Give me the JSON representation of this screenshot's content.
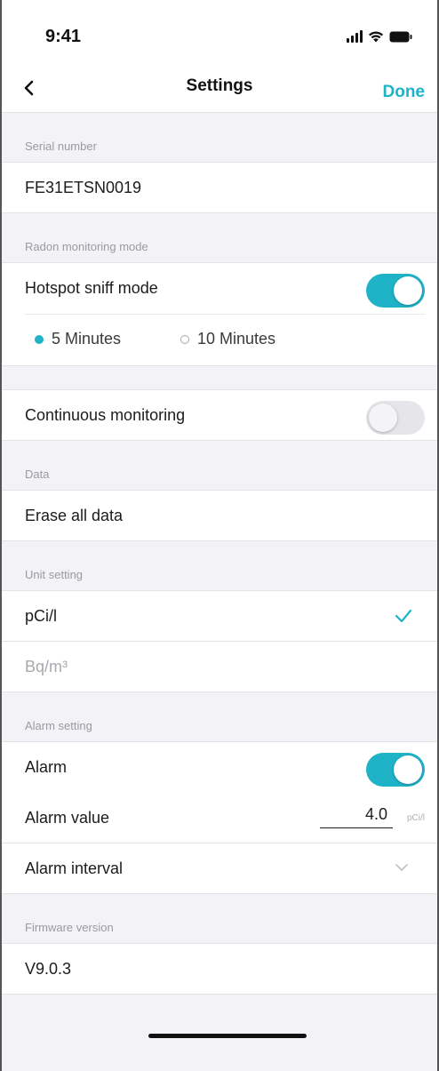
{
  "status_bar": {
    "time": "9:41",
    "icons": [
      "signal-icon",
      "wifi-icon",
      "battery-icon"
    ]
  },
  "nav": {
    "back_icon": "chevron-left-icon",
    "title": "Settings",
    "done_label": "Done"
  },
  "colors": {
    "accent": "#1fb3c7",
    "background": "#f2f2f7",
    "divider": "#e2e2e7"
  },
  "serial": {
    "header": "Serial number",
    "value": "FE31ETSN0019"
  },
  "radon_mode": {
    "header": "Radon monitoring mode",
    "hotspot_label": "Hotspot sniff mode",
    "hotspot_enabled": true,
    "options": [
      {
        "label": "5 Minutes",
        "selected": true
      },
      {
        "label": "10 Minutes",
        "selected": false
      }
    ],
    "continuous_label": "Continuous monitoring",
    "continuous_enabled": false
  },
  "data_section": {
    "header": "Data",
    "erase_label": "Erase all data"
  },
  "unit_setting": {
    "header": "Unit setting",
    "options": [
      {
        "label": "pCi/l",
        "selected": true
      },
      {
        "label": "Bq/m³",
        "selected": false
      }
    ]
  },
  "alarm_setting": {
    "header": "Alarm setting",
    "alarm_label": "Alarm",
    "alarm_enabled": true,
    "value_label": "Alarm value",
    "value": "4.0",
    "unit": "pCi/l",
    "interval_label": "Alarm interval"
  },
  "firmware": {
    "header": "Firmware version",
    "value": "V9.0.3"
  }
}
